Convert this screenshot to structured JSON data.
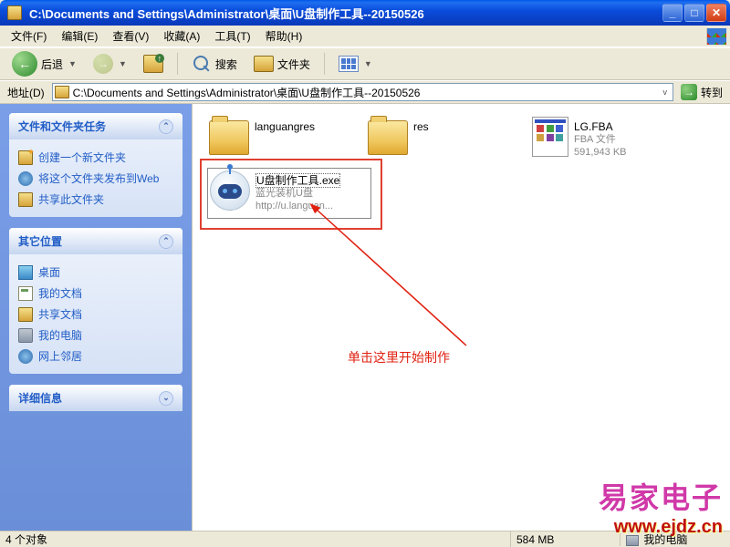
{
  "window": {
    "title": "C:\\Documents and Settings\\Administrator\\桌面\\U盘制作工具--20150526"
  },
  "menu": {
    "file": "文件(F)",
    "edit": "编辑(E)",
    "view": "查看(V)",
    "favorites": "收藏(A)",
    "tools": "工具(T)",
    "help": "帮助(H)"
  },
  "toolbar": {
    "back": "后退",
    "search": "搜索",
    "folders": "文件夹"
  },
  "addressbar": {
    "label": "地址(D)",
    "path": "C:\\Documents and Settings\\Administrator\\桌面\\U盘制作工具--20150526",
    "go": "转到"
  },
  "sidebar": {
    "tasks": {
      "header": "文件和文件夹任务",
      "new_folder": "创建一个新文件夹",
      "publish": "将这个文件夹发布到Web",
      "share": "共享此文件夹"
    },
    "other": {
      "header": "其它位置",
      "desktop": "桌面",
      "mydocs": "我的文档",
      "shared": "共享文档",
      "mycomputer": "我的电脑",
      "network": "网上邻居"
    },
    "details": {
      "header": "详细信息"
    }
  },
  "files": {
    "folder1": {
      "name": "languangres"
    },
    "folder2": {
      "name": "res"
    },
    "file1": {
      "name": "LG.FBA",
      "type": "FBA 文件",
      "size": "591,943 KB"
    },
    "exe": {
      "name": "U盘制作工具.exe",
      "desc": "蓝光装机U盘",
      "url": "http://u.languan..."
    }
  },
  "annotation": {
    "text": "单击这里开始制作"
  },
  "statusbar": {
    "left": "4 个对象",
    "size": "584 MB",
    "zone": "我的电脑"
  },
  "watermark": {
    "line1": "易家电子",
    "line2": "www.ejdz.cn"
  }
}
